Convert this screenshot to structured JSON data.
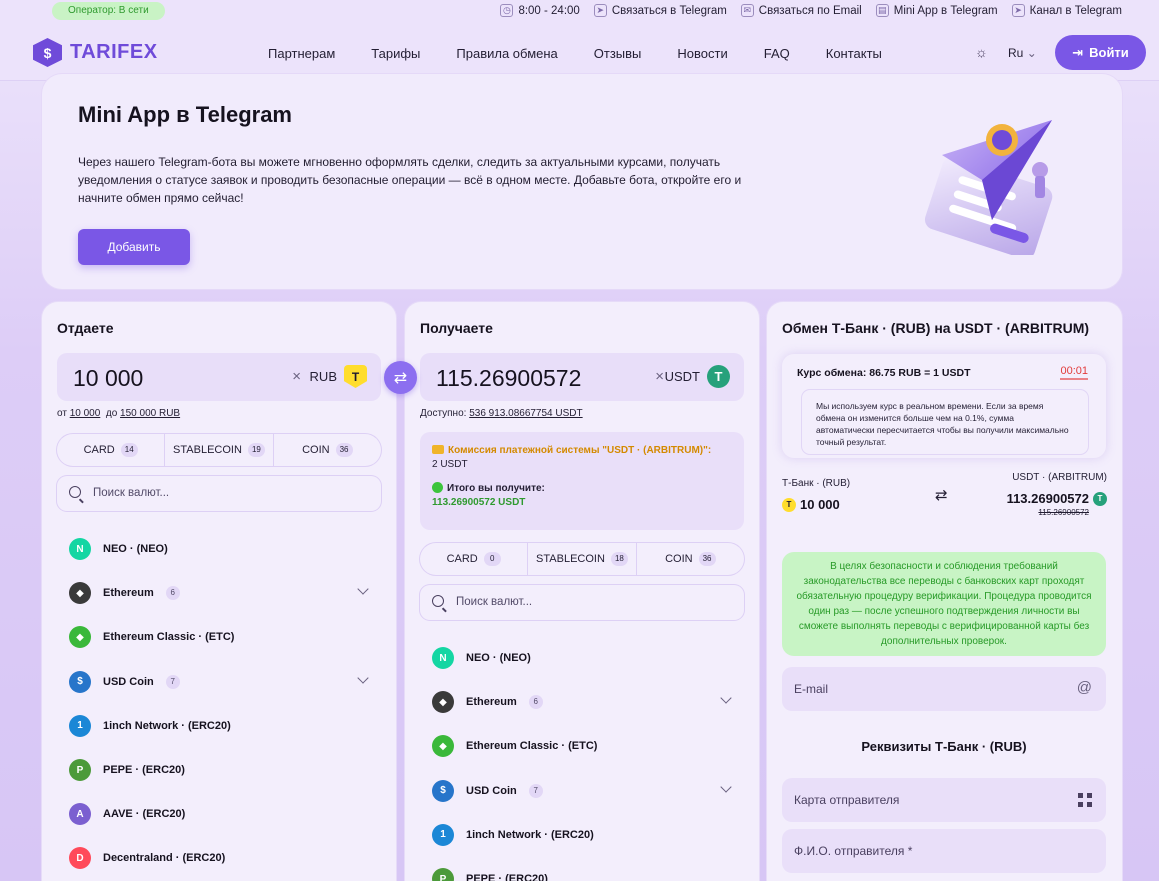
{
  "topbar": {
    "status": "Оператор: В сети",
    "links": [
      {
        "icon": "clock-icon",
        "glyph": "◷",
        "label": "8:00 - 24:00"
      },
      {
        "icon": "telegram-icon",
        "glyph": "➤",
        "label": "Связаться в Telegram"
      },
      {
        "icon": "email-icon",
        "glyph": "✉",
        "label": "Связаться по Email"
      },
      {
        "icon": "mini-app-icon",
        "glyph": "▤",
        "label": "Mini App в Telegram"
      },
      {
        "icon": "telegram-channel-icon",
        "glyph": "➤",
        "label": "Канал в Telegram"
      }
    ]
  },
  "header": {
    "brand": "TARIFEX",
    "nav": [
      "Партнерам",
      "Тарифы",
      "Правила обмена",
      "Отзывы",
      "Новости",
      "FAQ",
      "Контакты"
    ],
    "lang": "Ru",
    "login": "Войти"
  },
  "hero": {
    "title": "Mini App в Telegram",
    "text": "Через нашего Telegram-бота вы можете мгновенно оформлять сделки, следить за актуальными курсами, получать уведомления о статусе заявок и проводить безопасные операции — всё в одном месте. Добавьте бота, откройте его и начните обмен прямо сейчас!",
    "button": "Добавить"
  },
  "give": {
    "title": "Отдаете",
    "amount": "10 000",
    "currency": "RUB",
    "coin_glyph": "T",
    "limit_from_label": "от",
    "limit_from": "10 000",
    "limit_to_label": "до",
    "limit_to": "150 000 RUB",
    "tabs": [
      {
        "label": "CARD",
        "count": "14"
      },
      {
        "label": "STABLECOIN",
        "count": "19"
      },
      {
        "label": "COIN",
        "count": "36"
      }
    ],
    "search_placeholder": "Поиск валют...",
    "list": [
      {
        "name": "NEO · (NEO)",
        "count": "",
        "expand": false,
        "color": "#14d6a3",
        "glyph": "N"
      },
      {
        "name": "Ethereum",
        "count": "6",
        "expand": true,
        "color": "#3a3a3a",
        "glyph": "◆"
      },
      {
        "name": "Ethereum Classic · (ETC)",
        "count": "",
        "expand": false,
        "color": "#3ab83a",
        "glyph": "◆"
      },
      {
        "name": "USD Coin",
        "count": "7",
        "expand": true,
        "color": "#2775ca",
        "glyph": "$"
      },
      {
        "name": "1inch Network · (ERC20)",
        "count": "",
        "expand": false,
        "color": "#1b87d6",
        "glyph": "1"
      },
      {
        "name": "PEPE · (ERC20)",
        "count": "",
        "expand": false,
        "color": "#4c9a3a",
        "glyph": "P"
      },
      {
        "name": "AAVE · (ERC20)",
        "count": "",
        "expand": false,
        "color": "#7b5fd0",
        "glyph": "A"
      },
      {
        "name": "Decentraland · (ERC20)",
        "count": "",
        "expand": false,
        "color": "#ff4a5a",
        "glyph": "D"
      }
    ]
  },
  "receive": {
    "title": "Получаете",
    "amount": "115.26900572",
    "currency": "USDT",
    "coin_glyph": "T",
    "available_label": "Доступно:",
    "available": "536 913.08667754 USDT",
    "fee_label": "Комиссия платежной системы \"USDT · (ARBITRUM)\":",
    "fee_value": "2 USDT",
    "total_label": "Итого вы получите:",
    "total_value": "113.26900572 USDT",
    "tabs": [
      {
        "label": "CARD",
        "count": "0"
      },
      {
        "label": "STABLECOIN",
        "count": "18"
      },
      {
        "label": "COIN",
        "count": "36"
      }
    ],
    "search_placeholder": "Поиск валют...",
    "list": [
      {
        "name": "NEO · (NEO)",
        "count": "",
        "expand": false,
        "color": "#14d6a3",
        "glyph": "N"
      },
      {
        "name": "Ethereum",
        "count": "6",
        "expand": true,
        "color": "#3a3a3a",
        "glyph": "◆"
      },
      {
        "name": "Ethereum Classic · (ETC)",
        "count": "",
        "expand": false,
        "color": "#3ab83a",
        "glyph": "◆"
      },
      {
        "name": "USD Coin",
        "count": "7",
        "expand": true,
        "color": "#2775ca",
        "glyph": "$"
      },
      {
        "name": "1inch Network · (ERC20)",
        "count": "",
        "expand": false,
        "color": "#1b87d6",
        "glyph": "1"
      },
      {
        "name": "PEPE · (ERC20)",
        "count": "",
        "expand": false,
        "color": "#4c9a3a",
        "glyph": "P"
      }
    ]
  },
  "exchange": {
    "title": "Обмен Т-Банк · (RUB) на USDT · (ARBITRUM)",
    "rate": "Курс обмена: 86.75 RUB = 1 USDT",
    "timer": "00:01",
    "note": "Мы используем курс в реальном времени. Если за время обмена он изменится больше чем на 0.1%, сумма автоматически пересчитается чтобы вы получили максимально точный результат.",
    "from_label": "Т-Банк · (RUB)",
    "from_amount": "10 000",
    "to_label": "USDT · (ARBITRUM)",
    "to_amount": "113.26900572",
    "to_old": "115.26900572",
    "security": "В целях безопасности и соблюдения требований законодательства все переводы с банковских карт проходят обязательную процедуру верификации. Процедура проводится один раз — после успешного подтверждения личности вы сможете выполнять переводы с верифицированной карты без дополнительных проверок.",
    "email_placeholder": "E-mail",
    "requisites_title": "Реквизиты Т-Банк · (RUB)",
    "card_placeholder": "Карта отправителя",
    "name_placeholder": "Ф.И.О. отправителя *"
  },
  "colors": {
    "accent": "#7a57e6",
    "success": "#2f9a2f",
    "warning": "#d48a00",
    "timer": "#e23b3b"
  }
}
